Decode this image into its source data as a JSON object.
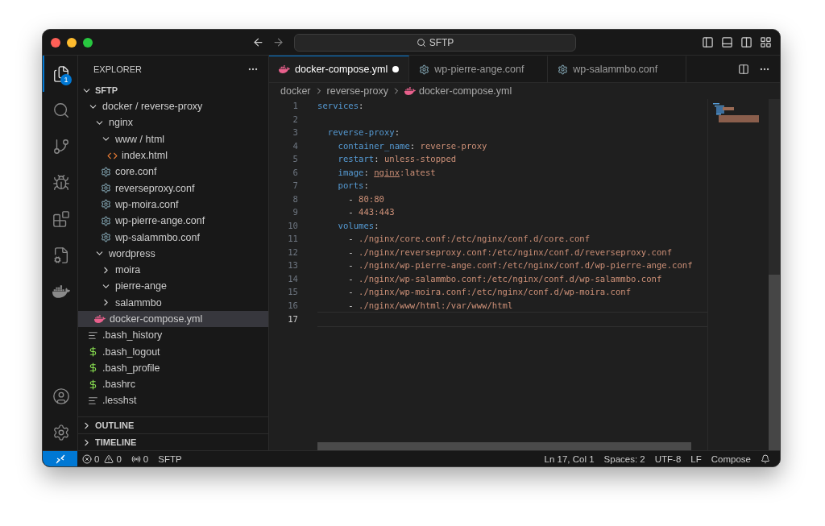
{
  "title_bar": {
    "command_center": "SFTP"
  },
  "activity_bar": {
    "items": [
      {
        "kind": "files",
        "selected": true,
        "badge": "1"
      },
      {
        "kind": "search",
        "selected": false
      },
      {
        "kind": "source-control",
        "selected": false
      },
      {
        "kind": "run",
        "selected": false
      },
      {
        "kind": "extensions",
        "selected": false
      },
      {
        "kind": "remote",
        "selected": false
      },
      {
        "kind": "docker",
        "selected": false
      }
    ],
    "bottom": [
      {
        "kind": "account"
      },
      {
        "kind": "settings"
      }
    ]
  },
  "sidebar": {
    "title": "EXPLORER",
    "sections": [
      {
        "title": "SFTP",
        "expanded": true,
        "tree": [
          {
            "label": "docker / reverse-proxy",
            "kind": "folder",
            "expanded": true,
            "selected": false,
            "children": [
              {
                "label": "nginx",
                "kind": "folder",
                "expanded": true,
                "selected": false,
                "children": [
                  {
                    "label": "www / html",
                    "kind": "folder",
                    "expanded": true,
                    "selected": false,
                    "children": [
                      {
                        "label": "index.html",
                        "kind": "html",
                        "selected": false
                      }
                    ]
                  },
                  {
                    "label": "core.conf",
                    "kind": "gear",
                    "selected": false
                  },
                  {
                    "label": "reverseproxy.conf",
                    "kind": "gear",
                    "selected": false
                  },
                  {
                    "label": "wp-moira.conf",
                    "kind": "gear",
                    "selected": false
                  },
                  {
                    "label": "wp-pierre-ange.conf",
                    "kind": "gear",
                    "selected": false
                  },
                  {
                    "label": "wp-salammbo.conf",
                    "kind": "gear",
                    "selected": false
                  }
                ]
              },
              {
                "label": "wordpress",
                "kind": "folder",
                "expanded": true,
                "selected": false,
                "children": [
                  {
                    "label": "moira",
                    "kind": "folder",
                    "expanded": false,
                    "selected": false
                  },
                  {
                    "label": "pierre-ange",
                    "kind": "folder",
                    "expanded": true,
                    "selected": false
                  },
                  {
                    "label": "salammbo",
                    "kind": "folder",
                    "expanded": false,
                    "selected": false
                  }
                ]
              },
              {
                "label": "docker-compose.yml",
                "kind": "docker",
                "selected": true
              }
            ]
          },
          {
            "label": ".bash_history",
            "kind": "lines",
            "selected": false
          },
          {
            "label": ".bash_logout",
            "kind": "dollar",
            "selected": false
          },
          {
            "label": ".bash_profile",
            "kind": "dollar",
            "selected": false
          },
          {
            "label": ".bashrc",
            "kind": "dollar",
            "selected": false
          },
          {
            "label": ".lesshst",
            "kind": "lines",
            "selected": false
          }
        ]
      },
      {
        "title": "OUTLINE",
        "expanded": false
      },
      {
        "title": "TIMELINE",
        "expanded": false
      }
    ]
  },
  "tabs": [
    {
      "label": "docker-compose.yml",
      "kind": "docker",
      "selected": true,
      "modified": true
    },
    {
      "label": "wp-pierre-ange.conf",
      "kind": "gear",
      "selected": false,
      "modified": false
    },
    {
      "label": "wp-salammbo.conf",
      "kind": "gear",
      "selected": false,
      "modified": false
    }
  ],
  "breadcrumbs": [
    {
      "label": "docker",
      "kind": "folder"
    },
    {
      "label": "reverse-proxy",
      "kind": "folder"
    },
    {
      "label": "docker-compose.yml",
      "kind": "docker"
    }
  ],
  "editor": {
    "lines": [
      {
        "number": "1",
        "current": false,
        "tokens": [
          {
            "kind": "key",
            "text": "services"
          },
          {
            "kind": "punct",
            "text": ":"
          }
        ]
      },
      {
        "number": "2",
        "current": false
      },
      {
        "number": "3",
        "current": false,
        "tokens": [
          {
            "kind": "key",
            "text": "  reverse-proxy"
          },
          {
            "kind": "punct",
            "text": ":"
          }
        ]
      },
      {
        "number": "4",
        "current": false,
        "tokens": [
          {
            "kind": "key",
            "text": "    container_name"
          },
          {
            "kind": "punct",
            "text": ": "
          },
          {
            "kind": "value",
            "text": "reverse-proxy"
          }
        ]
      },
      {
        "number": "5",
        "current": false,
        "tokens": [
          {
            "kind": "key",
            "text": "    restart"
          },
          {
            "kind": "punct",
            "text": ": "
          },
          {
            "kind": "value",
            "text": "unless-stopped"
          }
        ]
      },
      {
        "number": "6",
        "current": false,
        "tokens": [
          {
            "kind": "key",
            "text": "    image"
          },
          {
            "kind": "punct",
            "text": ": "
          },
          {
            "kind": "link",
            "text": "nginx"
          },
          {
            "kind": "value",
            "text": ":latest"
          }
        ]
      },
      {
        "number": "7",
        "current": false,
        "tokens": [
          {
            "kind": "key",
            "text": "    ports"
          },
          {
            "kind": "punct",
            "text": ":"
          }
        ]
      },
      {
        "number": "8",
        "current": false,
        "tokens": [
          {
            "kind": "punct",
            "text": "      - "
          },
          {
            "kind": "value",
            "text": "80:80"
          }
        ]
      },
      {
        "number": "9",
        "current": false,
        "tokens": [
          {
            "kind": "punct",
            "text": "      - "
          },
          {
            "kind": "value",
            "text": "443:443"
          }
        ]
      },
      {
        "number": "10",
        "current": false,
        "tokens": [
          {
            "kind": "key",
            "text": "    volumes"
          },
          {
            "kind": "punct",
            "text": ":"
          }
        ]
      },
      {
        "number": "11",
        "current": false,
        "tokens": [
          {
            "kind": "punct",
            "text": "      - "
          },
          {
            "kind": "value",
            "text": "./nginx/core.conf:/etc/nginx/conf.d/core.conf"
          }
        ]
      },
      {
        "number": "12",
        "current": false,
        "tokens": [
          {
            "kind": "punct",
            "text": "      - "
          },
          {
            "kind": "value",
            "text": "./nginx/reverseproxy.conf:/etc/nginx/conf.d/reverseproxy.conf"
          }
        ]
      },
      {
        "number": "13",
        "current": false,
        "tokens": [
          {
            "kind": "punct",
            "text": "      - "
          },
          {
            "kind": "value",
            "text": "./nginx/wp-pierre-ange.conf:/etc/nginx/conf.d/wp-pierre-ange.conf"
          }
        ]
      },
      {
        "number": "14",
        "current": false,
        "tokens": [
          {
            "kind": "punct",
            "text": "      - "
          },
          {
            "kind": "value",
            "text": "./nginx/wp-salammbo.conf:/etc/nginx/conf.d/wp-salammbo.conf"
          }
        ]
      },
      {
        "number": "15",
        "current": false,
        "tokens": [
          {
            "kind": "punct",
            "text": "      - "
          },
          {
            "kind": "value",
            "text": "./nginx/wp-moira.conf:/etc/nginx/conf.d/wp-moira.conf"
          }
        ]
      },
      {
        "number": "16",
        "current": false,
        "tokens": [
          {
            "kind": "punct",
            "text": "      - "
          },
          {
            "kind": "value",
            "text": "./nginx/www/html:/var/www/html"
          }
        ]
      },
      {
        "number": "17",
        "current": true
      }
    ]
  },
  "status_bar": {
    "left": [
      {
        "kind": "errors",
        "text": "0"
      },
      {
        "kind": "warnings",
        "text": "0"
      },
      {
        "kind": "ports",
        "text": "0"
      },
      {
        "kind": "text",
        "text": "SFTP"
      }
    ],
    "right": [
      {
        "kind": "text",
        "text": "Ln 17, Col 1"
      },
      {
        "kind": "text",
        "text": "Spaces: 2"
      },
      {
        "kind": "text",
        "text": "UTF-8"
      },
      {
        "kind": "text",
        "text": "LF"
      },
      {
        "kind": "text",
        "text": "Compose"
      },
      {
        "kind": "bell"
      }
    ]
  }
}
